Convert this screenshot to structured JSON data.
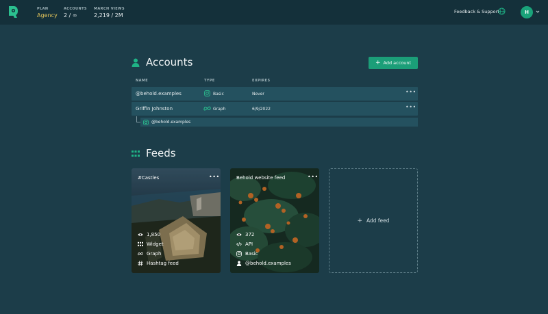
{
  "header": {
    "stats": [
      {
        "label": "PLAN",
        "value": "Agency"
      },
      {
        "label": "ACCOUNTS",
        "value": "2 / ∞"
      },
      {
        "label": "MARCH VIEWS",
        "value": "2,219 / 2M"
      }
    ],
    "support_label": "Feedback & Support",
    "avatar_initial": "H",
    "icons": [
      "behold-logo-icon",
      "globe-icon",
      "chevron-down-icon"
    ]
  },
  "accounts": {
    "title": "Accounts",
    "add_button_label": "Add account",
    "columns": [
      "NAME",
      "TYPE",
      "EXPIRES"
    ],
    "rows": [
      {
        "name": "@behold.examples",
        "type": "Basic",
        "type_icon": "instagram-icon",
        "expires": "Never"
      },
      {
        "name": "Griffin Johnston",
        "type": "Graph",
        "type_icon": "meta-icon",
        "expires": "6/9/2022"
      }
    ],
    "sub_account": {
      "name": "@behold.examples",
      "icon": "instagram-icon"
    }
  },
  "feeds": {
    "title": "Feeds",
    "cards": [
      {
        "title": "#Castles",
        "meta": [
          {
            "icon": "eye-icon",
            "text": "1,850"
          },
          {
            "icon": "grid-icon",
            "text": "Widget"
          },
          {
            "icon": "meta-icon",
            "text": "Graph"
          },
          {
            "icon": "hash-icon",
            "text": "Hashtag feed"
          }
        ]
      },
      {
        "title": "Behold website feed",
        "meta": [
          {
            "icon": "eye-icon",
            "text": "372"
          },
          {
            "icon": "code-icon",
            "text": "API"
          },
          {
            "icon": "instagram-icon",
            "text": "Basic"
          },
          {
            "icon": "user-icon",
            "text": "@behold.examples"
          }
        ]
      }
    ],
    "add_feed_label": "Add feed"
  },
  "colors": {
    "accent": "#1b9e78",
    "background": "#1c3d49",
    "topbar": "#14303a",
    "row": "#24515f",
    "plan": "#e7c75b"
  }
}
